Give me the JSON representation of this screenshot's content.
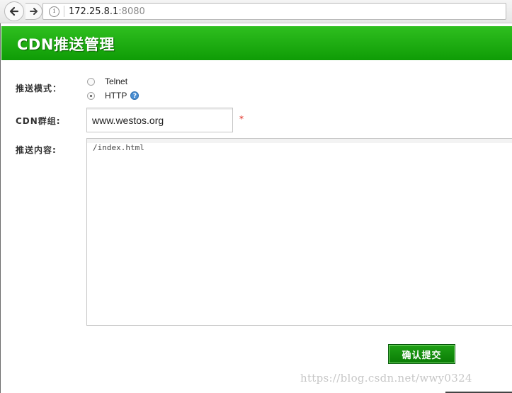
{
  "browser": {
    "url_host": "172.25.8.1",
    "url_port": ":8080",
    "info_icon": "i"
  },
  "header": {
    "title": "CDN推送管理"
  },
  "form": {
    "push_mode_label": "推送模式：",
    "push_mode_options": [
      {
        "label": "Telnet",
        "checked": false
      },
      {
        "label": "HTTP",
        "checked": true
      }
    ],
    "help_icon": "?",
    "cdn_group_label": "CDN群组:",
    "cdn_group_value": "www.westos.org",
    "required_mark": "*",
    "push_content_label": "推送内容:",
    "push_content_value": "/index.html",
    "submit_label": "确认提交"
  },
  "watermark": "https://blog.csdn.net/wwy0324",
  "colors": {
    "header_green": "#1aaa12",
    "required_red": "#e0261b",
    "help_blue": "#4b8fd3"
  }
}
